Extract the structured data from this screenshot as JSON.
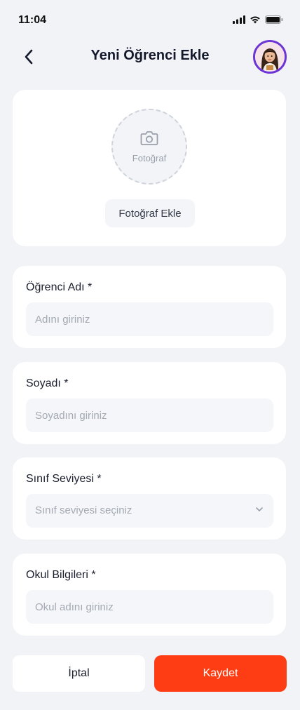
{
  "status": {
    "time": "11:04"
  },
  "header": {
    "title": "Yeni Öğrenci Ekle"
  },
  "photo": {
    "placeholder_label": "Fotoğraf",
    "add_button_label": "Fotoğraf Ekle"
  },
  "fields": {
    "first_name": {
      "label": "Öğrenci Adı *",
      "placeholder": "Adını giriniz",
      "value": ""
    },
    "last_name": {
      "label": "Soyadı *",
      "placeholder": "Soyadını giriniz",
      "value": ""
    },
    "grade": {
      "label": "Sınıf Seviyesi *",
      "placeholder": "Sınıf seviyesi seçiniz"
    },
    "school": {
      "label": "Okul Bilgileri *",
      "placeholder": "Okul adını giriniz",
      "value": ""
    }
  },
  "actions": {
    "cancel_label": "İptal",
    "save_label": "Kaydet"
  },
  "colors": {
    "accent": "#ff3d14",
    "avatar_ring": "#6d34d6",
    "background": "#f1f3f6"
  },
  "icons": {
    "back": "chevron-left-icon",
    "camera": "camera-icon",
    "dropdown": "chevron-down-icon",
    "signal": "signal-icon",
    "wifi": "wifi-icon",
    "battery": "battery-icon"
  }
}
